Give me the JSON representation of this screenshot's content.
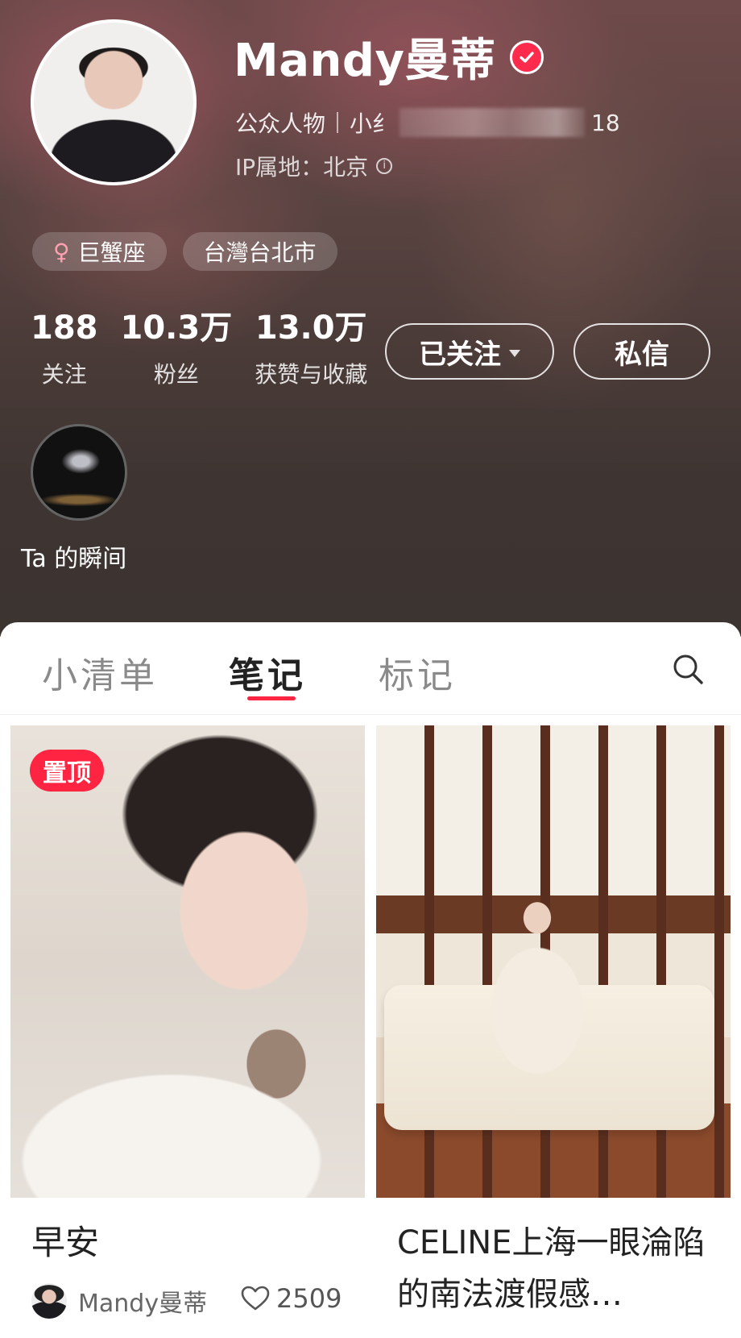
{
  "profile": {
    "name": "Mandy曼蒂",
    "tag_public": "公众人物",
    "tag_partial": "小纟",
    "tag_tail": "18",
    "ip_location": "IP属地：北京",
    "chips": [
      {
        "label": "巨蟹座",
        "icon": "female-icon"
      },
      {
        "label": "台灣台北市"
      }
    ],
    "stats": [
      {
        "value": "188",
        "label": "关注"
      },
      {
        "value": "10.3万",
        "label": "粉丝"
      },
      {
        "value": "13.0万",
        "label": "获赞与收藏"
      }
    ],
    "follow_button": "已关注",
    "message_button": "私信",
    "moments_label": "Ta 的瞬间",
    "accent_color": "#ff2442"
  },
  "tabs": [
    {
      "label": "小清单"
    },
    {
      "label": "笔记",
      "active": true
    },
    {
      "label": "标记"
    }
  ],
  "notes": [
    {
      "pinned_badge": "置顶",
      "title": "早安",
      "author": "Mandy曼蒂",
      "likes": "2509"
    },
    {
      "title": "CELINE上海一眼淪陷的南法渡假感…"
    }
  ]
}
